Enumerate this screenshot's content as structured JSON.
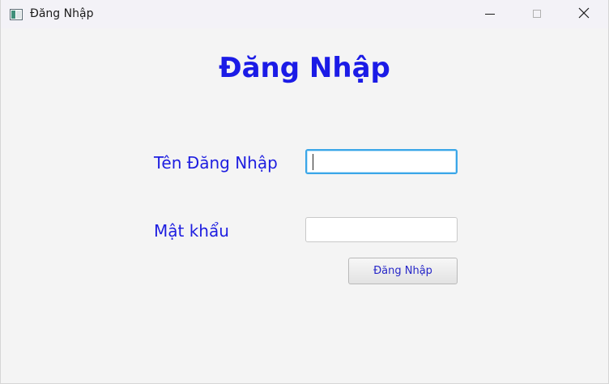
{
  "window": {
    "title": "Đăng Nhập",
    "app_icon": "java-app-icon",
    "controls": {
      "minimize_icon": "minimize-icon",
      "maximize_icon": "maximize-icon",
      "close_icon": "close-icon"
    }
  },
  "form": {
    "heading": "Đăng Nhập",
    "username_label": "Tên Đăng Nhập",
    "username_value": "",
    "password_label": "Mật khẩu",
    "password_value": "",
    "submit_label": "Đăng Nhập"
  },
  "colors": {
    "heading": "#1b1be6",
    "label": "#1d1de0",
    "focus_border": "#3aa6e8",
    "background": "#f4f4f4"
  }
}
